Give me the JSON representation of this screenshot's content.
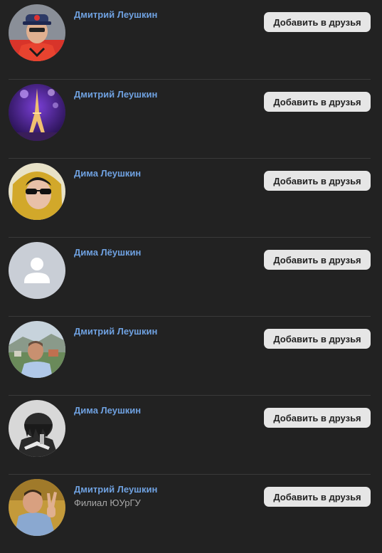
{
  "results": [
    {
      "name": "Дмитрий Леушкин",
      "subtitle": "",
      "action": "Добавить в друзья",
      "avatar_icon": "hockey-photo-avatar"
    },
    {
      "name": "Дмитрий Леушкин",
      "subtitle": "",
      "action": "Добавить в друзья",
      "avatar_icon": "eiffel-tower-avatar"
    },
    {
      "name": "Дима Леушкин",
      "subtitle": "",
      "action": "Добавить в друзья",
      "avatar_icon": "sunglasses-photo-avatar"
    },
    {
      "name": "Дима Лёушкин",
      "subtitle": "",
      "action": "Добавить в друзья",
      "avatar_icon": "default-user-icon"
    },
    {
      "name": "Дмитрий Леушкин",
      "subtitle": "",
      "action": "Добавить в друзья",
      "avatar_icon": "outdoor-photo-avatar"
    },
    {
      "name": "Дима Леушкин",
      "subtitle": "",
      "action": "Добавить в друзья",
      "avatar_icon": "anime-avatar"
    },
    {
      "name": "Дмитрий Леушкин",
      "subtitle": "Филиал ЮУрГУ",
      "action": "Добавить в друзья",
      "avatar_icon": "peace-sign-photo-avatar"
    }
  ],
  "colors": {
    "background": "#222222",
    "name_link": "#6fa1e0",
    "button_bg": "#e6e6e6",
    "button_text": "#222222",
    "divider": "#3a3a3a",
    "subtitle": "#a8a8a8"
  }
}
